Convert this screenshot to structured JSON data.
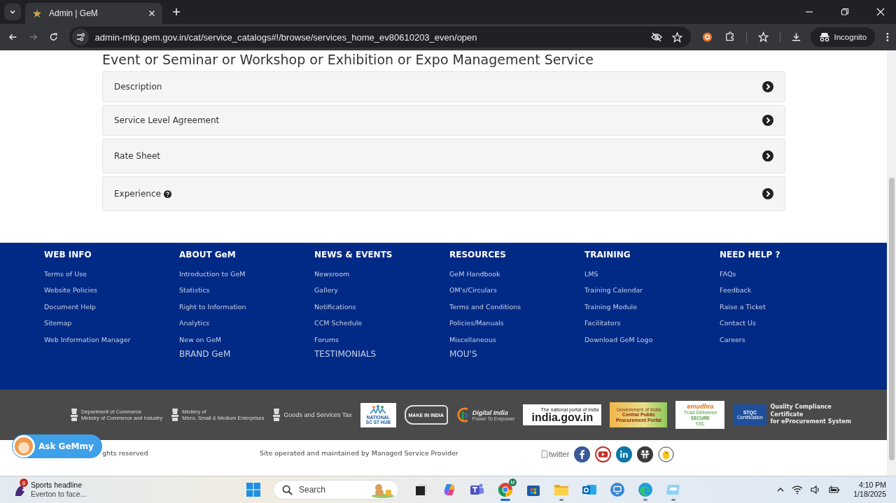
{
  "browser": {
    "tab_title": "Admin | GeM",
    "url": "admin-mkp.gem.gov.in/cat/service_catalogs#!/browse/services_home_ev80610203_even/open",
    "profile_label": "Incognito"
  },
  "page": {
    "title": "Event or Seminar or Workshop or Exhibition or Expo Management Service",
    "sections": [
      {
        "label": "Description",
        "help": false
      },
      {
        "label": "Service Level Agreement",
        "help": false
      },
      {
        "label": "Rate Sheet",
        "help": false
      },
      {
        "label": "Experience",
        "help": true
      }
    ]
  },
  "footer": {
    "columns": [
      {
        "heading": "WEB INFO",
        "links": [
          "Terms of Use",
          "Website Policies",
          "Document Help",
          "Sitemap",
          "Web Information Manager"
        ]
      },
      {
        "heading": "ABOUT GeM",
        "links": [
          "Introduction to GeM",
          "Statistics",
          "Right to Information",
          "Analytics",
          "New on GeM"
        ],
        "extra": "BRAND GeM"
      },
      {
        "heading": "NEWS & EVENTS",
        "links": [
          "Newsroom",
          "Gallery",
          "Notifications",
          "CCM Schedule",
          "Forums"
        ],
        "extra": "TESTIMONIALS"
      },
      {
        "heading": "RESOURCES",
        "links": [
          "GeM Handbook",
          "OM's/Circulars",
          "Terms and Conditions",
          "Policies/Manuals",
          "Miscellaneous"
        ],
        "extra": "MOU'S"
      },
      {
        "heading": "TRAINING",
        "links": [
          "LMS",
          "Training Calendar",
          "Training Module",
          "Facilitators",
          "Download GeM Logo"
        ]
      },
      {
        "heading": "NEED HELP ?",
        "links": [
          "FAQs",
          "Feedback",
          "Raise a Ticket",
          "Contact Us",
          "Careers"
        ]
      }
    ]
  },
  "partners": [
    {
      "kind": "emblem",
      "lines": [
        "Department of Commerce",
        "Ministry of  Commerce and Industry"
      ]
    },
    {
      "kind": "emblem",
      "lines": [
        "Ministry of",
        "Micro, Small & Medium Enterprises"
      ]
    },
    {
      "kind": "emblem",
      "lines": [
        "Goods and Services Tax"
      ]
    },
    {
      "kind": "scst",
      "lines": [
        "NATIONAL",
        "SC ST HUB"
      ]
    },
    {
      "kind": "lion",
      "lines": [
        "MAKE IN INDIA"
      ]
    },
    {
      "kind": "digital",
      "lines": [
        "Digital India",
        "Power To Empower"
      ]
    },
    {
      "kind": "portal",
      "lines": [
        "The national portal of India",
        "india.gov.in"
      ]
    },
    {
      "kind": "cppp",
      "lines": [
        "Government of India",
        "Central Public",
        "Procurement Portal"
      ]
    },
    {
      "kind": "emudhra",
      "lines": [
        "emudhra",
        "Trust Delivered",
        "SECURE",
        "SSL"
      ]
    },
    {
      "kind": "stqc",
      "lines": [
        "STQC",
        "Certification",
        "Quality Compliance",
        "Certificate",
        "for eProcurement System"
      ]
    }
  ],
  "bottom": {
    "rights": "ghts reserved",
    "operated": "Site operated and maintained by Managed Service Provider",
    "twitter_alt": "twitter",
    "social": [
      {
        "kind": "facebook"
      },
      {
        "kind": "youtube"
      },
      {
        "kind": "linkedin"
      },
      {
        "kind": "slideshare"
      },
      {
        "kind": "koo"
      }
    ]
  },
  "chatbot": {
    "label": "Ask GeMmy"
  },
  "taskbar": {
    "news": {
      "badge": "8",
      "title": "Sports headline",
      "subtitle": "Everton to face..."
    },
    "search": {
      "placeholder": "Search"
    },
    "apps": [
      {
        "kind": "taskview",
        "running": false,
        "selected": false
      },
      {
        "kind": "copilot",
        "running": false,
        "selected": false
      },
      {
        "kind": "teams",
        "running": false,
        "selected": false
      },
      {
        "kind": "chrome",
        "running": true,
        "selected": true,
        "badge": "M"
      },
      {
        "kind": "store",
        "running": false,
        "selected": false
      },
      {
        "kind": "explorer",
        "running": true,
        "selected": false
      },
      {
        "kind": "outlook",
        "running": false,
        "selected": false
      },
      {
        "kind": "remote",
        "running": false,
        "selected": false
      },
      {
        "kind": "edge",
        "running": true,
        "selected": false
      },
      {
        "kind": "display",
        "running": true,
        "selected": false
      }
    ],
    "time": "4:10 PM",
    "date": "1/18/2025"
  }
}
